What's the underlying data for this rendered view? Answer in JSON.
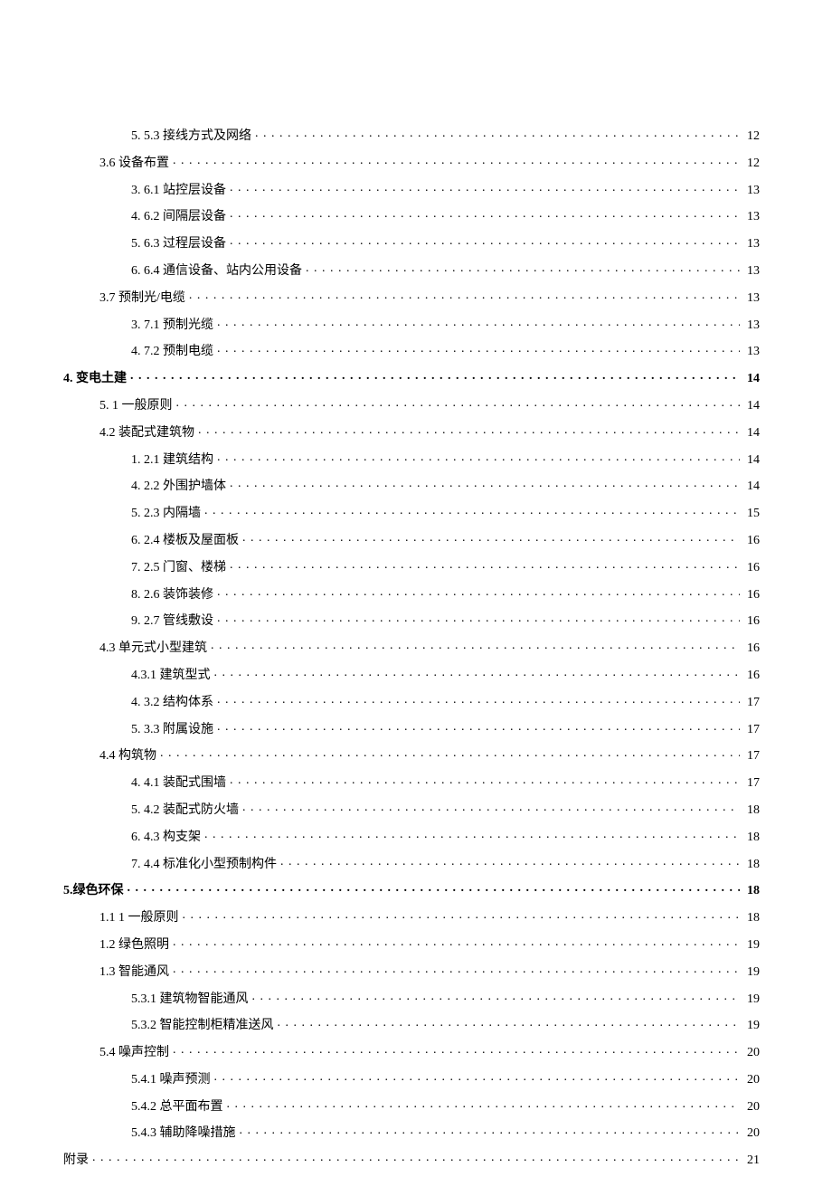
{
  "toc": [
    {
      "indent": 2,
      "bold": false,
      "label": "5.  5.3 接线方式及网络",
      "page": "12"
    },
    {
      "indent": 1,
      "bold": false,
      "label": "3.6      设备布置",
      "page": "12"
    },
    {
      "indent": 2,
      "bold": false,
      "label": "3.  6.1 站控层设备",
      "page": "13"
    },
    {
      "indent": 2,
      "bold": false,
      "label": "4.  6.2 间隔层设备",
      "page": "13"
    },
    {
      "indent": 2,
      "bold": false,
      "label": "5.  6.3 过程层设备",
      "page": "13"
    },
    {
      "indent": 2,
      "bold": false,
      "label": "6.  6.4 通信设备、站内公用设备",
      "page": "13"
    },
    {
      "indent": 1,
      "bold": false,
      "label": "3.7 预制光/电缆",
      "page": "13"
    },
    {
      "indent": 2,
      "bold": false,
      "label": "3.  7.1 预制光缆",
      "page": "13"
    },
    {
      "indent": 2,
      "bold": false,
      "label": "4.  7.2 预制电缆",
      "page": "13"
    },
    {
      "indent": 0,
      "bold": true,
      "label": "4. 变电土建",
      "page": "14"
    },
    {
      "indent": 1,
      "bold": false,
      "label": "5.  1   一般原则",
      "page": "14"
    },
    {
      "indent": 1,
      "bold": false,
      "label": "4.2      装配式建筑物",
      "page": "14"
    },
    {
      "indent": 2,
      "bold": false,
      "label": "1.  2.1 建筑结构",
      "page": "14"
    },
    {
      "indent": 2,
      "bold": false,
      "label": "4.  2.2 外围护墙体",
      "page": "14"
    },
    {
      "indent": 2,
      "bold": false,
      "label": "5.  2.3 内隔墙",
      "page": "15"
    },
    {
      "indent": 2,
      "bold": false,
      "label": "6.  2.4 楼板及屋面板",
      "page": "16"
    },
    {
      "indent": 2,
      "bold": false,
      "label": "7.  2.5 门窗、楼梯",
      "page": "16"
    },
    {
      "indent": 2,
      "bold": false,
      "label": "8.  2.6 装饰装修",
      "page": "16"
    },
    {
      "indent": 2,
      "bold": false,
      "label": "9.  2.7 管线敷设",
      "page": "16"
    },
    {
      "indent": 1,
      "bold": false,
      "label": "4.3      单元式小型建筑",
      "page": "16"
    },
    {
      "indent": 2,
      "bold": false,
      "label": "4.3.1    建筑型式",
      "page": "16"
    },
    {
      "indent": 2,
      "bold": false,
      "label": "4.  3.2 结构体系",
      "page": "17"
    },
    {
      "indent": 2,
      "bold": false,
      "label": "5.  3.3 附属设施",
      "page": "17"
    },
    {
      "indent": 1,
      "bold": false,
      "label": "4.4      构筑物",
      "page": "17"
    },
    {
      "indent": 2,
      "bold": false,
      "label": "4.  4.1 装配式围墙",
      "page": "17"
    },
    {
      "indent": 2,
      "bold": false,
      "label": "5.  4.2 装配式防火墙",
      "page": "18"
    },
    {
      "indent": 2,
      "bold": false,
      "label": "6.  4.3 构支架",
      "page": "18"
    },
    {
      "indent": 2,
      "bold": false,
      "label": "7.  4.4 标准化小型预制构件",
      "page": "18"
    },
    {
      "indent": 0,
      "bold": true,
      "label": "5.绿色环保",
      "page": "18"
    },
    {
      "indent": 1,
      "bold": false,
      "label": "1.1 1   一般原则",
      "page": "18"
    },
    {
      "indent": 1,
      "bold": false,
      "label": "1.2      绿色照明",
      "page": "19"
    },
    {
      "indent": 1,
      "bold": false,
      "label": "1.3      智能通风",
      "page": "19"
    },
    {
      "indent": 2,
      "bold": false,
      "label": "5.3.1 建筑物智能通风",
      "page": "19"
    },
    {
      "indent": 2,
      "bold": false,
      "label": "5.3.2 智能控制柜精准送风",
      "page": "19"
    },
    {
      "indent": 1,
      "bold": false,
      "label": "5.4 噪声控制",
      "page": "20"
    },
    {
      "indent": 2,
      "bold": false,
      "label": "5.4.1 噪声预测",
      "page": "20"
    },
    {
      "indent": 2,
      "bold": false,
      "label": "5.4.2 总平面布置",
      "page": "20"
    },
    {
      "indent": 2,
      "bold": false,
      "label": "5.4.3 辅助降噪措施",
      "page": "20"
    },
    {
      "indent": 0,
      "bold": false,
      "label": "附录",
      "page": "21"
    }
  ]
}
